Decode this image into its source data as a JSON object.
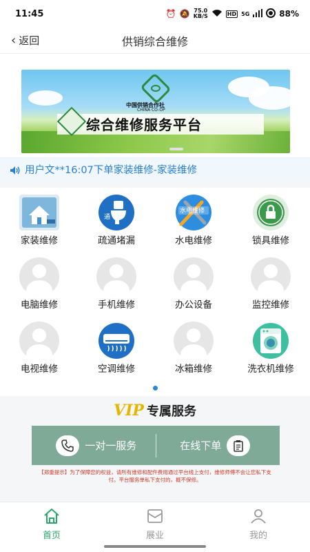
{
  "status_bar": {
    "time": "11:45",
    "speed_value": "75.0",
    "speed_unit": "KB/S",
    "hd": "HD",
    "network": "5G",
    "battery": "88%"
  },
  "nav": {
    "back_label": "返回",
    "title": "供销综合维修"
  },
  "banner": {
    "org_cn": "中国供销合作社",
    "org_en": "CHINA CO-OP",
    "headline": "综合维修服务平台"
  },
  "notice": {
    "text": "用户文**16:07下单家装维修-家装维修"
  },
  "services": [
    {
      "label": "家装维修",
      "icon": "house-repair-icon"
    },
    {
      "label": "疏通堵漏",
      "icon": "toilet-unclog-icon"
    },
    {
      "label": "水电维修",
      "icon": "water-electric-icon",
      "badge": "水电维修"
    },
    {
      "label": "锁具维修",
      "icon": "lock-icon"
    },
    {
      "label": "电脑维修",
      "icon": "avatar-placeholder-icon"
    },
    {
      "label": "手机维修",
      "icon": "avatar-placeholder-icon"
    },
    {
      "label": "办公设备",
      "icon": "avatar-placeholder-icon"
    },
    {
      "label": "监控维修",
      "icon": "avatar-placeholder-icon"
    },
    {
      "label": "电视维修",
      "icon": "avatar-placeholder-icon"
    },
    {
      "label": "空调维修",
      "icon": "air-conditioner-icon"
    },
    {
      "label": "冰箱维修",
      "icon": "avatar-placeholder-icon"
    },
    {
      "label": "洗衣机维修",
      "icon": "washing-machine-icon"
    }
  ],
  "vip": {
    "logo": "VIP",
    "title": "专属服务",
    "one_on_one": "一对一服务",
    "online_order": "在线下单",
    "disclaimer": "【郑重提示】为了保障您的权益，请所有维修和配件费用通过平台线上支付，维修师傅不会让您私下支付。平台服务单私下支付的，概不保修。"
  },
  "tabs": [
    {
      "label": "首页",
      "icon": "home-icon",
      "active": true
    },
    {
      "label": "展业",
      "icon": "inbox-icon",
      "active": false
    },
    {
      "label": "我的",
      "icon": "user-icon",
      "active": false
    }
  ],
  "colors": {
    "accent_green": "#2aa86a",
    "notice_blue": "#2a7fcf",
    "vip_bar": "#7faa98",
    "vip_gold": "#e7b400",
    "warning_red": "#d23a2a"
  }
}
